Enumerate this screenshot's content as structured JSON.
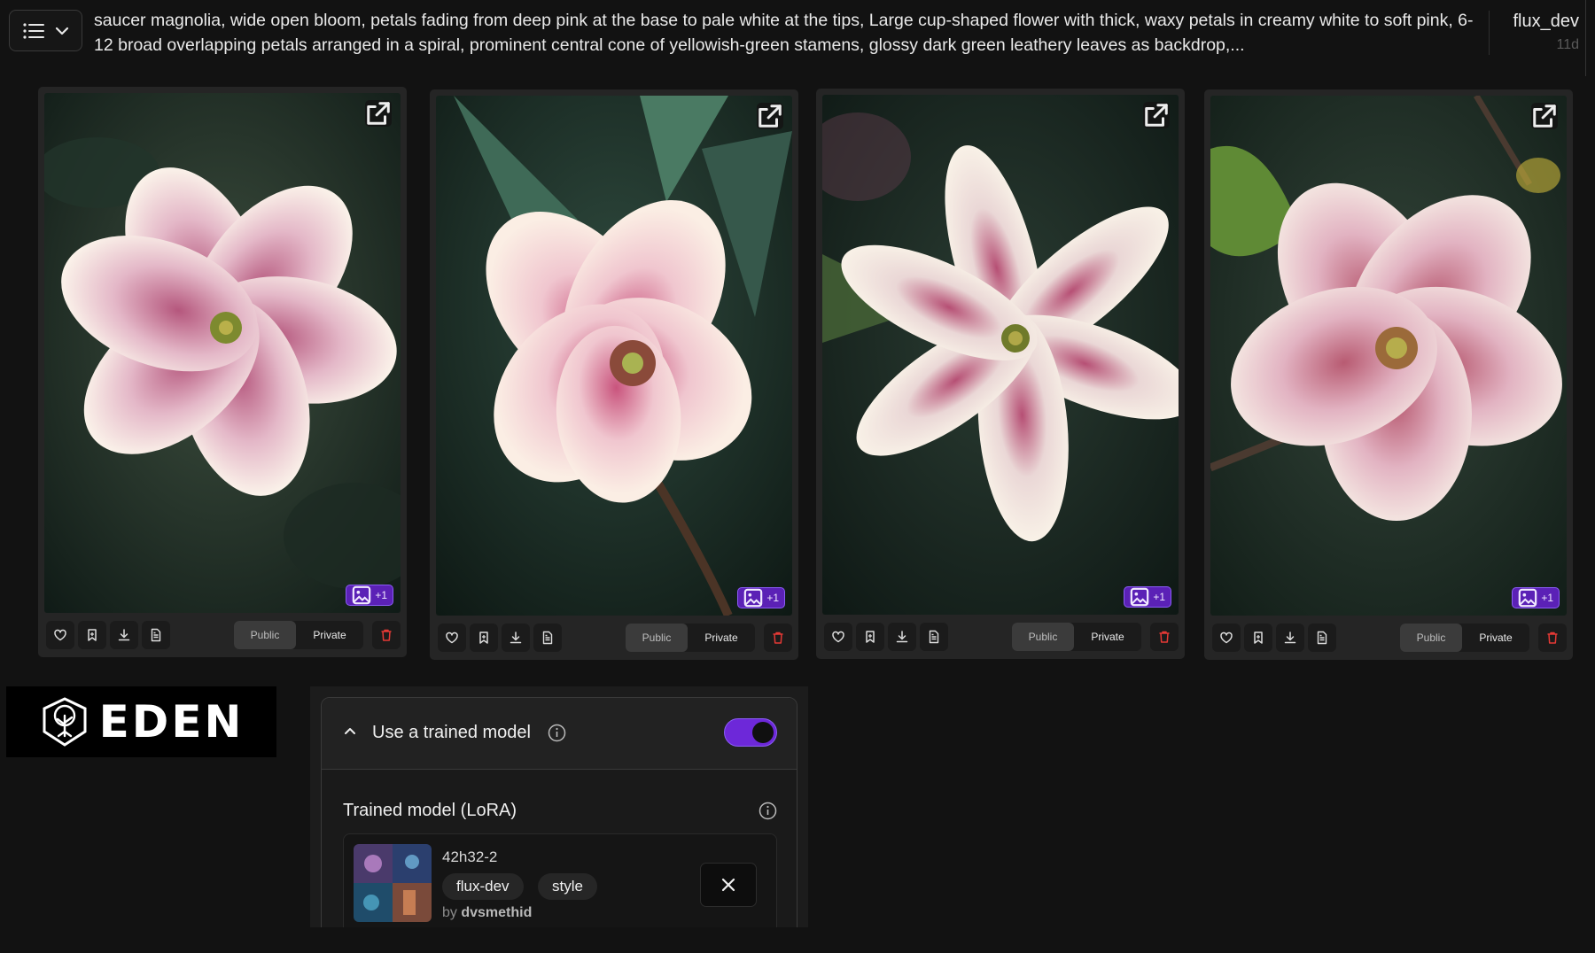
{
  "header": {
    "prompt": "saucer magnolia, wide open bloom, petals fading from deep pink at the base to pale white at the tips, Large cup-shaped flower with thick, waxy petals in creamy white to soft pink, 6-12 broad overlapping petals arranged in a spiral, prominent central cone of yellowish-green stamens, glossy dark green leathery leaves as backdrop,...",
    "model": "flux_dev",
    "age": "11d"
  },
  "cards": [
    {
      "badge": "+1",
      "public_label": "Public",
      "private_label": "Private"
    },
    {
      "badge": "+1",
      "public_label": "Public",
      "private_label": "Private"
    },
    {
      "badge": "+1",
      "public_label": "Public",
      "private_label": "Private"
    },
    {
      "badge": "+1",
      "public_label": "Public",
      "private_label": "Private"
    }
  ],
  "logo": {
    "text": "EDEN"
  },
  "lora_panel": {
    "section_title": "Use a trained model",
    "toggle_on": true,
    "field_title": "Trained model (LoRA)",
    "model": {
      "name": "42h32-2",
      "tags": [
        "flux-dev",
        "style"
      ],
      "by_prefix": "by",
      "author": "dvsmethid"
    }
  },
  "colors": {
    "accent": "#6d28d9",
    "badge_bg": "#5b21b6",
    "delete": "#e53935",
    "background": "#121212"
  },
  "icons": [
    "list-icon",
    "chevron-down-icon",
    "external-link-icon",
    "image-icon",
    "heart-icon",
    "bookmark-icon",
    "download-icon",
    "document-icon",
    "trash-icon",
    "chevron-up-icon",
    "info-icon",
    "close-icon"
  ]
}
